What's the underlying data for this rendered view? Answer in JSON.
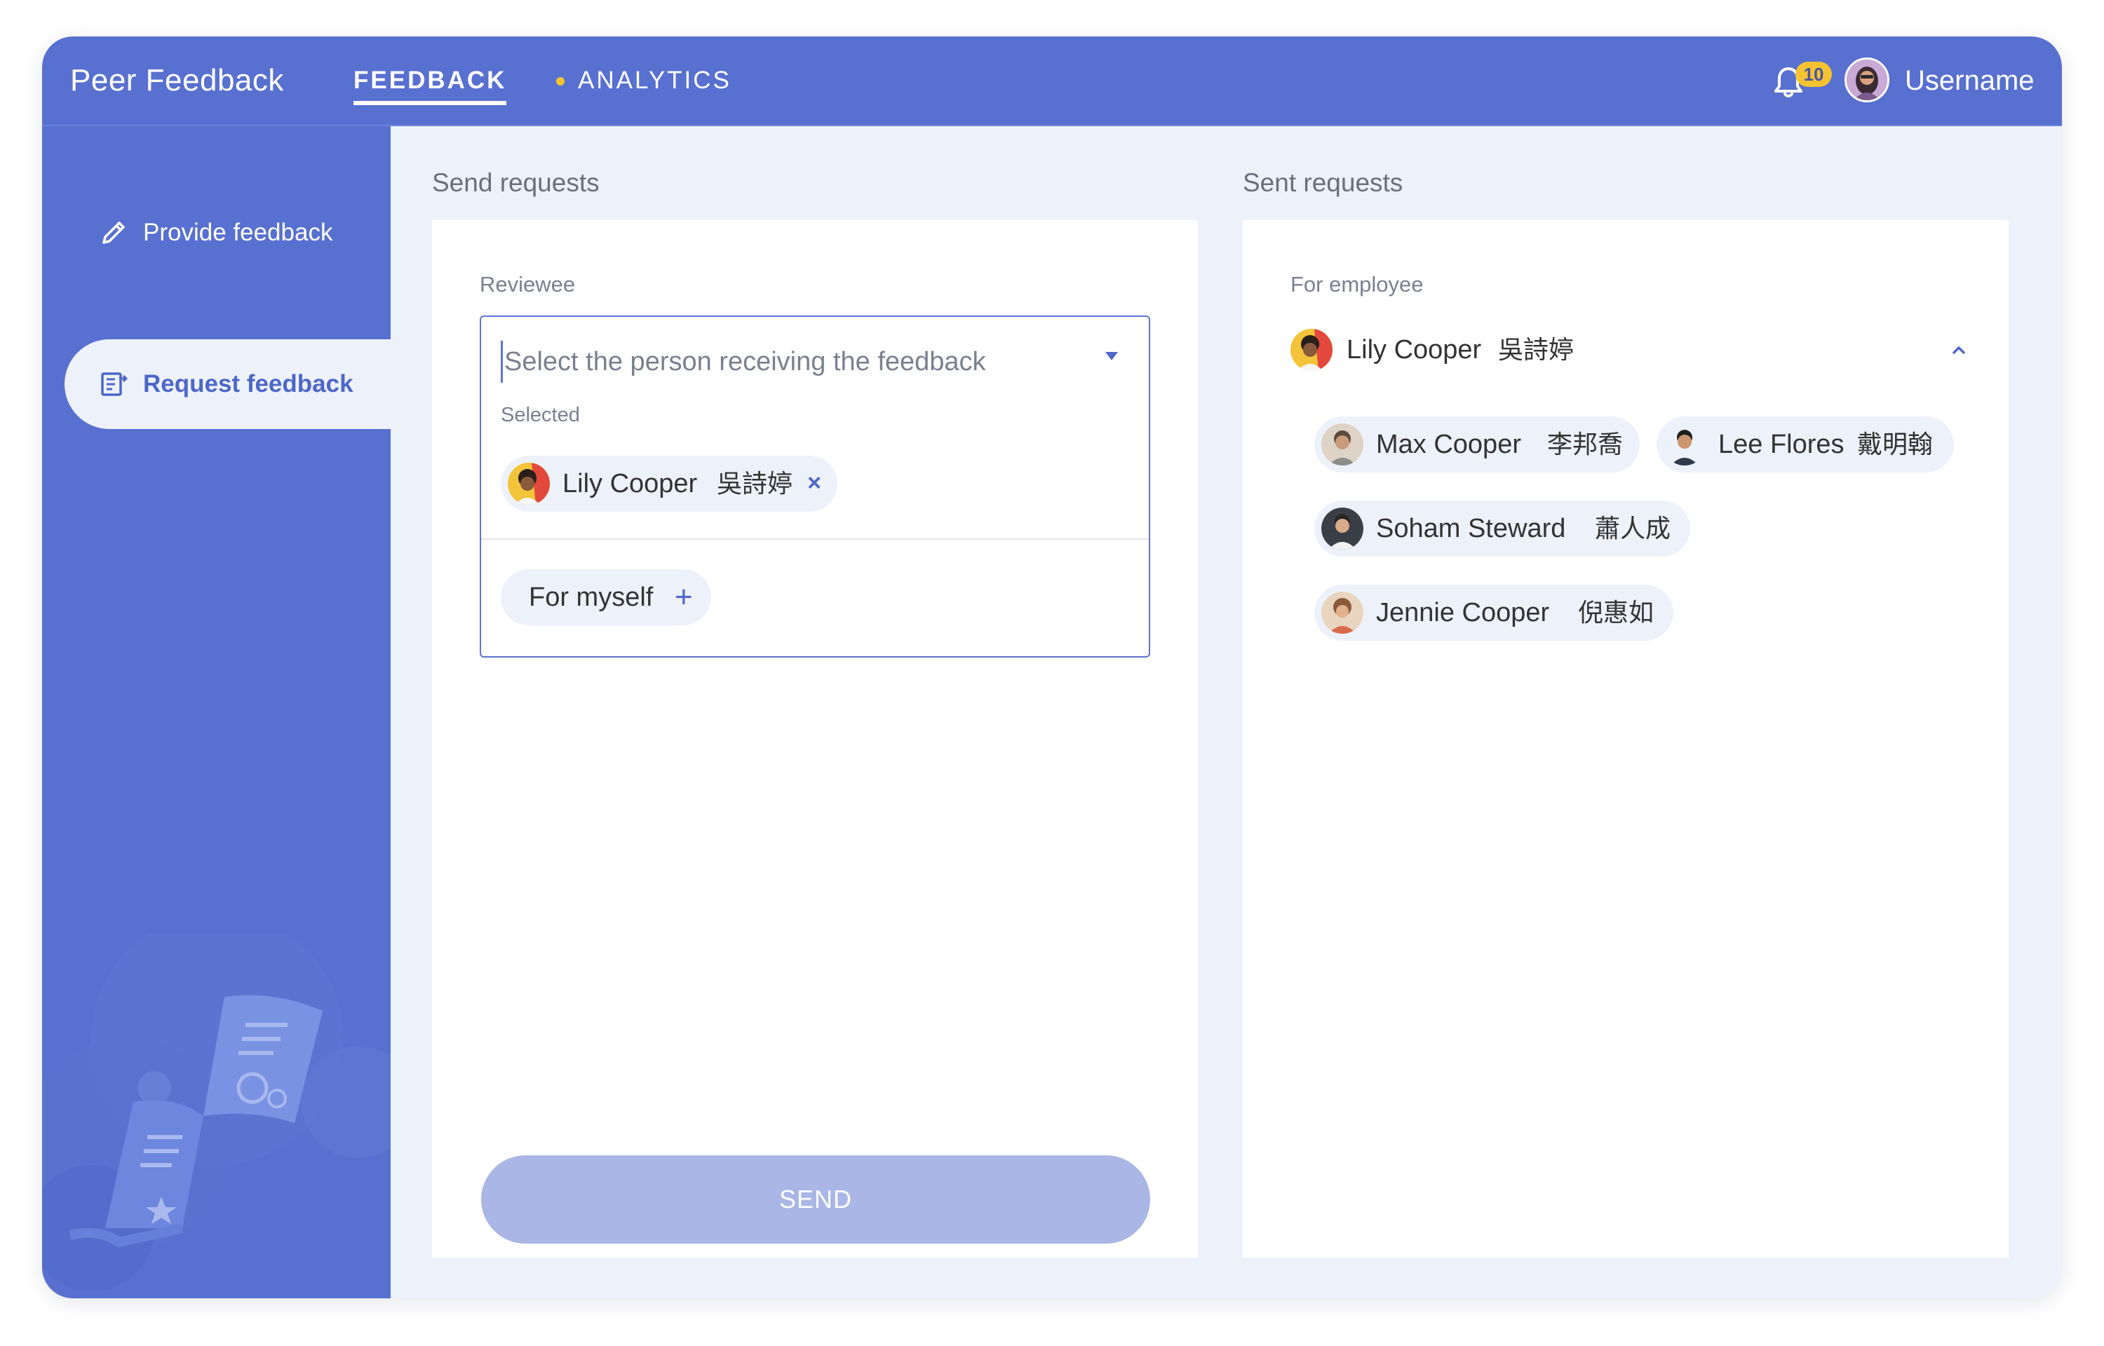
{
  "app": {
    "brand": "Peer Feedback",
    "nav": {
      "feedback": "FEEDBACK",
      "analytics": "ANALYTICS"
    },
    "notifications": "10",
    "username": "Username"
  },
  "colors": {
    "primary": "#5870cf",
    "accent_yellow": "#f5c232",
    "background": "#edf1fa",
    "send_button_disabled": "#a9b6e6"
  },
  "sidebar": {
    "items": [
      {
        "label": "Provide feedback",
        "icon": "pencil-icon",
        "active": false
      },
      {
        "label": "Request feedback",
        "icon": "request-document-icon",
        "active": true
      }
    ]
  },
  "send_requests": {
    "title": "Send requests",
    "reviewee_label": "Reviewee",
    "placeholder": "Select the person receiving the feedback",
    "selected_label": "Selected",
    "selected_person": {
      "name": "Lily Cooper",
      "name_cjk": "吳詩婷"
    },
    "for_myself": "For myself",
    "send_button": "SEND"
  },
  "sent_requests": {
    "title": "Sent requests",
    "for_employee_label": "For employee",
    "employee": {
      "name": "Lily Cooper",
      "name_cjk": "吳詩婷"
    },
    "reviewers": [
      {
        "name": "Max Cooper",
        "name_cjk": "李邦喬"
      },
      {
        "name": "Lee Flores",
        "name_cjk": "戴明翰"
      },
      {
        "name": "Soham Steward",
        "name_cjk": "蕭人成"
      },
      {
        "name": "Jennie Cooper",
        "name_cjk": "倪惠如"
      }
    ]
  }
}
